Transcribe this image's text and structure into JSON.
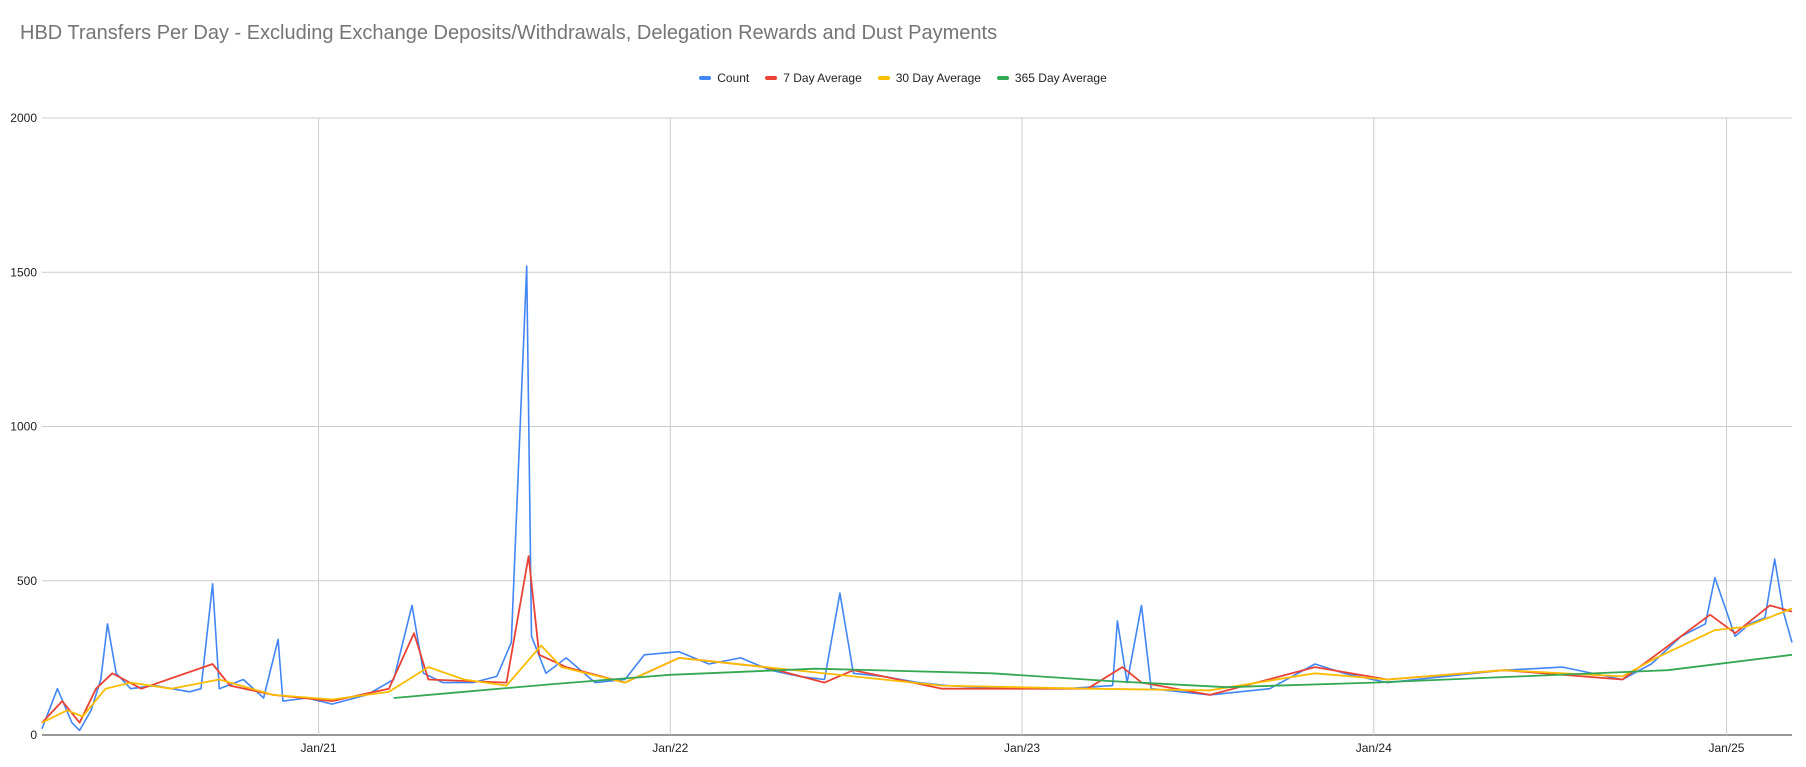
{
  "chart_data": {
    "type": "line",
    "title": "HBD Transfers Per Day - Excluding Exchange Deposits/Withdrawals, Delegation Rewards and Dust Payments",
    "xlabel": "",
    "ylabel": "",
    "ylim": [
      0,
      2000
    ],
    "y_ticks": [
      "0",
      "500",
      "1000",
      "1500",
      "2000"
    ],
    "x_ticks": [
      "Jan/21",
      "Jan/22",
      "Jan/23",
      "Jan/24",
      "Jan/25"
    ],
    "x_range": [
      "2020-03-20",
      "2025-03-10"
    ],
    "grid": true,
    "legend_position": "top",
    "series": [
      {
        "name": "Count",
        "color": "#4285f4",
        "points": [
          [
            "2020-03-20",
            20
          ],
          [
            "2020-04-05",
            150
          ],
          [
            "2020-04-20",
            40
          ],
          [
            "2020-04-28",
            15
          ],
          [
            "2020-05-10",
            80
          ],
          [
            "2020-05-20",
            180
          ],
          [
            "2020-05-27",
            360
          ],
          [
            "2020-06-05",
            200
          ],
          [
            "2020-06-20",
            150
          ],
          [
            "2020-07-15",
            160
          ],
          [
            "2020-08-20",
            140
          ],
          [
            "2020-09-01",
            150
          ],
          [
            "2020-09-13",
            490
          ],
          [
            "2020-09-20",
            150
          ],
          [
            "2020-10-15",
            180
          ],
          [
            "2020-11-05",
            120
          ],
          [
            "2020-11-20",
            310
          ],
          [
            "2020-11-25",
            110
          ],
          [
            "2020-12-20",
            120
          ],
          [
            "2021-01-15",
            100
          ],
          [
            "2021-02-20",
            130
          ],
          [
            "2021-03-20",
            180
          ],
          [
            "2021-04-08",
            420
          ],
          [
            "2021-04-20",
            200
          ],
          [
            "2021-05-10",
            170
          ],
          [
            "2021-06-10",
            170
          ],
          [
            "2021-07-05",
            190
          ],
          [
            "2021-07-20",
            300
          ],
          [
            "2021-08-05",
            1520
          ],
          [
            "2021-08-10",
            320
          ],
          [
            "2021-08-25",
            200
          ],
          [
            "2021-09-15",
            250
          ],
          [
            "2021-10-15",
            170
          ],
          [
            "2021-11-15",
            180
          ],
          [
            "2021-12-05",
            260
          ],
          [
            "2022-01-10",
            270
          ],
          [
            "2022-02-10",
            230
          ],
          [
            "2022-03-15",
            250
          ],
          [
            "2022-04-15",
            210
          ],
          [
            "2022-05-15",
            190
          ],
          [
            "2022-06-10",
            180
          ],
          [
            "2022-06-26",
            460
          ],
          [
            "2022-07-10",
            200
          ],
          [
            "2022-08-10",
            190
          ],
          [
            "2022-09-15",
            170
          ],
          [
            "2022-10-15",
            160
          ],
          [
            "2022-12-15",
            150
          ],
          [
            "2023-02-15",
            150
          ],
          [
            "2023-04-05",
            160
          ],
          [
            "2023-04-10",
            370
          ],
          [
            "2023-04-20",
            170
          ],
          [
            "2023-05-05",
            420
          ],
          [
            "2023-05-15",
            150
          ],
          [
            "2023-07-15",
            130
          ],
          [
            "2023-09-15",
            150
          ],
          [
            "2023-11-01",
            230
          ],
          [
            "2023-12-01",
            200
          ],
          [
            "2024-01-15",
            170
          ],
          [
            "2024-03-15",
            190
          ],
          [
            "2024-05-15",
            210
          ],
          [
            "2024-07-15",
            220
          ],
          [
            "2024-09-15",
            180
          ],
          [
            "2024-10-15",
            230
          ],
          [
            "2024-11-15",
            320
          ],
          [
            "2024-12-10",
            360
          ],
          [
            "2024-12-20",
            510
          ],
          [
            "2025-01-10",
            320
          ],
          [
            "2025-01-25",
            360
          ],
          [
            "2025-02-10",
            380
          ],
          [
            "2025-02-20",
            570
          ],
          [
            "2025-03-01",
            400
          ],
          [
            "2025-03-10",
            300
          ]
        ]
      },
      {
        "name": "7 Day Average",
        "color": "#ea4335",
        "points": [
          [
            "2020-03-20",
            40
          ],
          [
            "2020-04-10",
            110
          ],
          [
            "2020-04-28",
            40
          ],
          [
            "2020-05-15",
            150
          ],
          [
            "2020-06-01",
            200
          ],
          [
            "2020-07-01",
            150
          ],
          [
            "2020-09-13",
            230
          ],
          [
            "2020-10-01",
            160
          ],
          [
            "2020-11-15",
            130
          ],
          [
            "2021-01-15",
            110
          ],
          [
            "2021-03-15",
            150
          ],
          [
            "2021-04-10",
            330
          ],
          [
            "2021-04-25",
            180
          ],
          [
            "2021-07-15",
            170
          ],
          [
            "2021-08-07",
            580
          ],
          [
            "2021-08-18",
            260
          ],
          [
            "2021-09-15",
            220
          ],
          [
            "2021-11-15",
            170
          ],
          [
            "2022-01-10",
            250
          ],
          [
            "2022-04-10",
            220
          ],
          [
            "2022-06-10",
            170
          ],
          [
            "2022-07-10",
            210
          ],
          [
            "2022-10-10",
            150
          ],
          [
            "2023-03-10",
            150
          ],
          [
            "2023-04-15",
            220
          ],
          [
            "2023-05-05",
            170
          ],
          [
            "2023-07-15",
            130
          ],
          [
            "2023-11-01",
            220
          ],
          [
            "2024-01-15",
            180
          ],
          [
            "2024-05-15",
            210
          ],
          [
            "2024-09-15",
            180
          ],
          [
            "2024-10-20",
            260
          ],
          [
            "2024-12-15",
            390
          ],
          [
            "2025-01-10",
            330
          ],
          [
            "2025-02-15",
            420
          ],
          [
            "2025-03-10",
            400
          ]
        ]
      },
      {
        "name": "30 Day Average",
        "color": "#fbbc04",
        "points": [
          [
            "2020-03-20",
            40
          ],
          [
            "2020-04-15",
            80
          ],
          [
            "2020-05-01",
            60
          ],
          [
            "2020-05-25",
            150
          ],
          [
            "2020-06-20",
            170
          ],
          [
            "2020-08-01",
            150
          ],
          [
            "2020-09-20",
            180
          ],
          [
            "2020-11-15",
            130
          ],
          [
            "2021-01-15",
            115
          ],
          [
            "2021-03-15",
            140
          ],
          [
            "2021-04-25",
            220
          ],
          [
            "2021-06-01",
            180
          ],
          [
            "2021-07-15",
            160
          ],
          [
            "2021-08-20",
            290
          ],
          [
            "2021-09-10",
            220
          ],
          [
            "2021-11-15",
            170
          ],
          [
            "2022-01-10",
            250
          ],
          [
            "2022-04-10",
            220
          ],
          [
            "2022-07-10",
            190
          ],
          [
            "2022-10-10",
            160
          ],
          [
            "2023-03-10",
            150
          ],
          [
            "2023-07-15",
            145
          ],
          [
            "2023-11-01",
            200
          ],
          [
            "2024-01-15",
            180
          ],
          [
            "2024-05-15",
            210
          ],
          [
            "2024-09-15",
            190
          ],
          [
            "2024-10-20",
            250
          ],
          [
            "2024-12-20",
            340
          ],
          [
            "2025-01-20",
            350
          ],
          [
            "2025-03-10",
            410
          ]
        ]
      },
      {
        "name": "365 Day Average",
        "color": "#34a853",
        "points": [
          [
            "2021-03-20",
            120
          ],
          [
            "2021-06-01",
            140
          ],
          [
            "2021-09-01",
            165
          ],
          [
            "2022-01-01",
            195
          ],
          [
            "2022-06-01",
            215
          ],
          [
            "2022-12-01",
            200
          ],
          [
            "2023-04-01",
            175
          ],
          [
            "2023-08-01",
            155
          ],
          [
            "2024-01-01",
            170
          ],
          [
            "2024-06-01",
            190
          ],
          [
            "2024-11-01",
            210
          ],
          [
            "2025-03-10",
            260
          ]
        ]
      }
    ]
  }
}
